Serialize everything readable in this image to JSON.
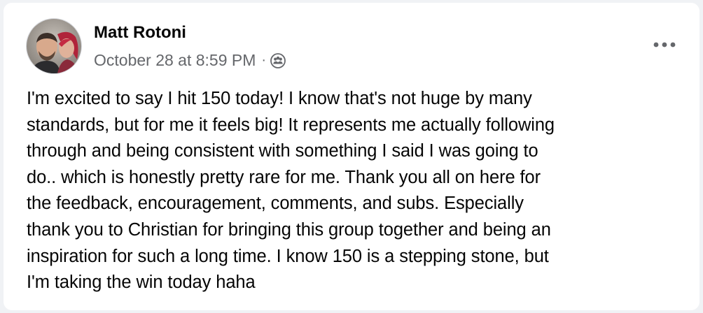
{
  "post": {
    "author_name": "Matt Rotoni",
    "timestamp": "October 28 at 8:59 PM",
    "separator": "·",
    "audience_icon": "group-members-icon",
    "more_icon": "more-options-icon",
    "body": "I'm excited to say I hit 150 today! I know that's not huge by many\nstandards, but for me it feels big! It represents me actually following\nthrough and being consistent with something I said I was going to\ndo.. which is honestly pretty rare for me. Thank you all on here for\nthe feedback, encouragement, comments, and subs. Especially\nthank you to Christian for bringing this group together and being an\ninspiration for such a long time. I know 150 is a stepping stone, but\nI'm taking the win today haha"
  },
  "colors": {
    "card_background": "#ffffff",
    "page_background": "#f0f2f5",
    "primary_text": "#050505",
    "secondary_text": "#65676b"
  }
}
